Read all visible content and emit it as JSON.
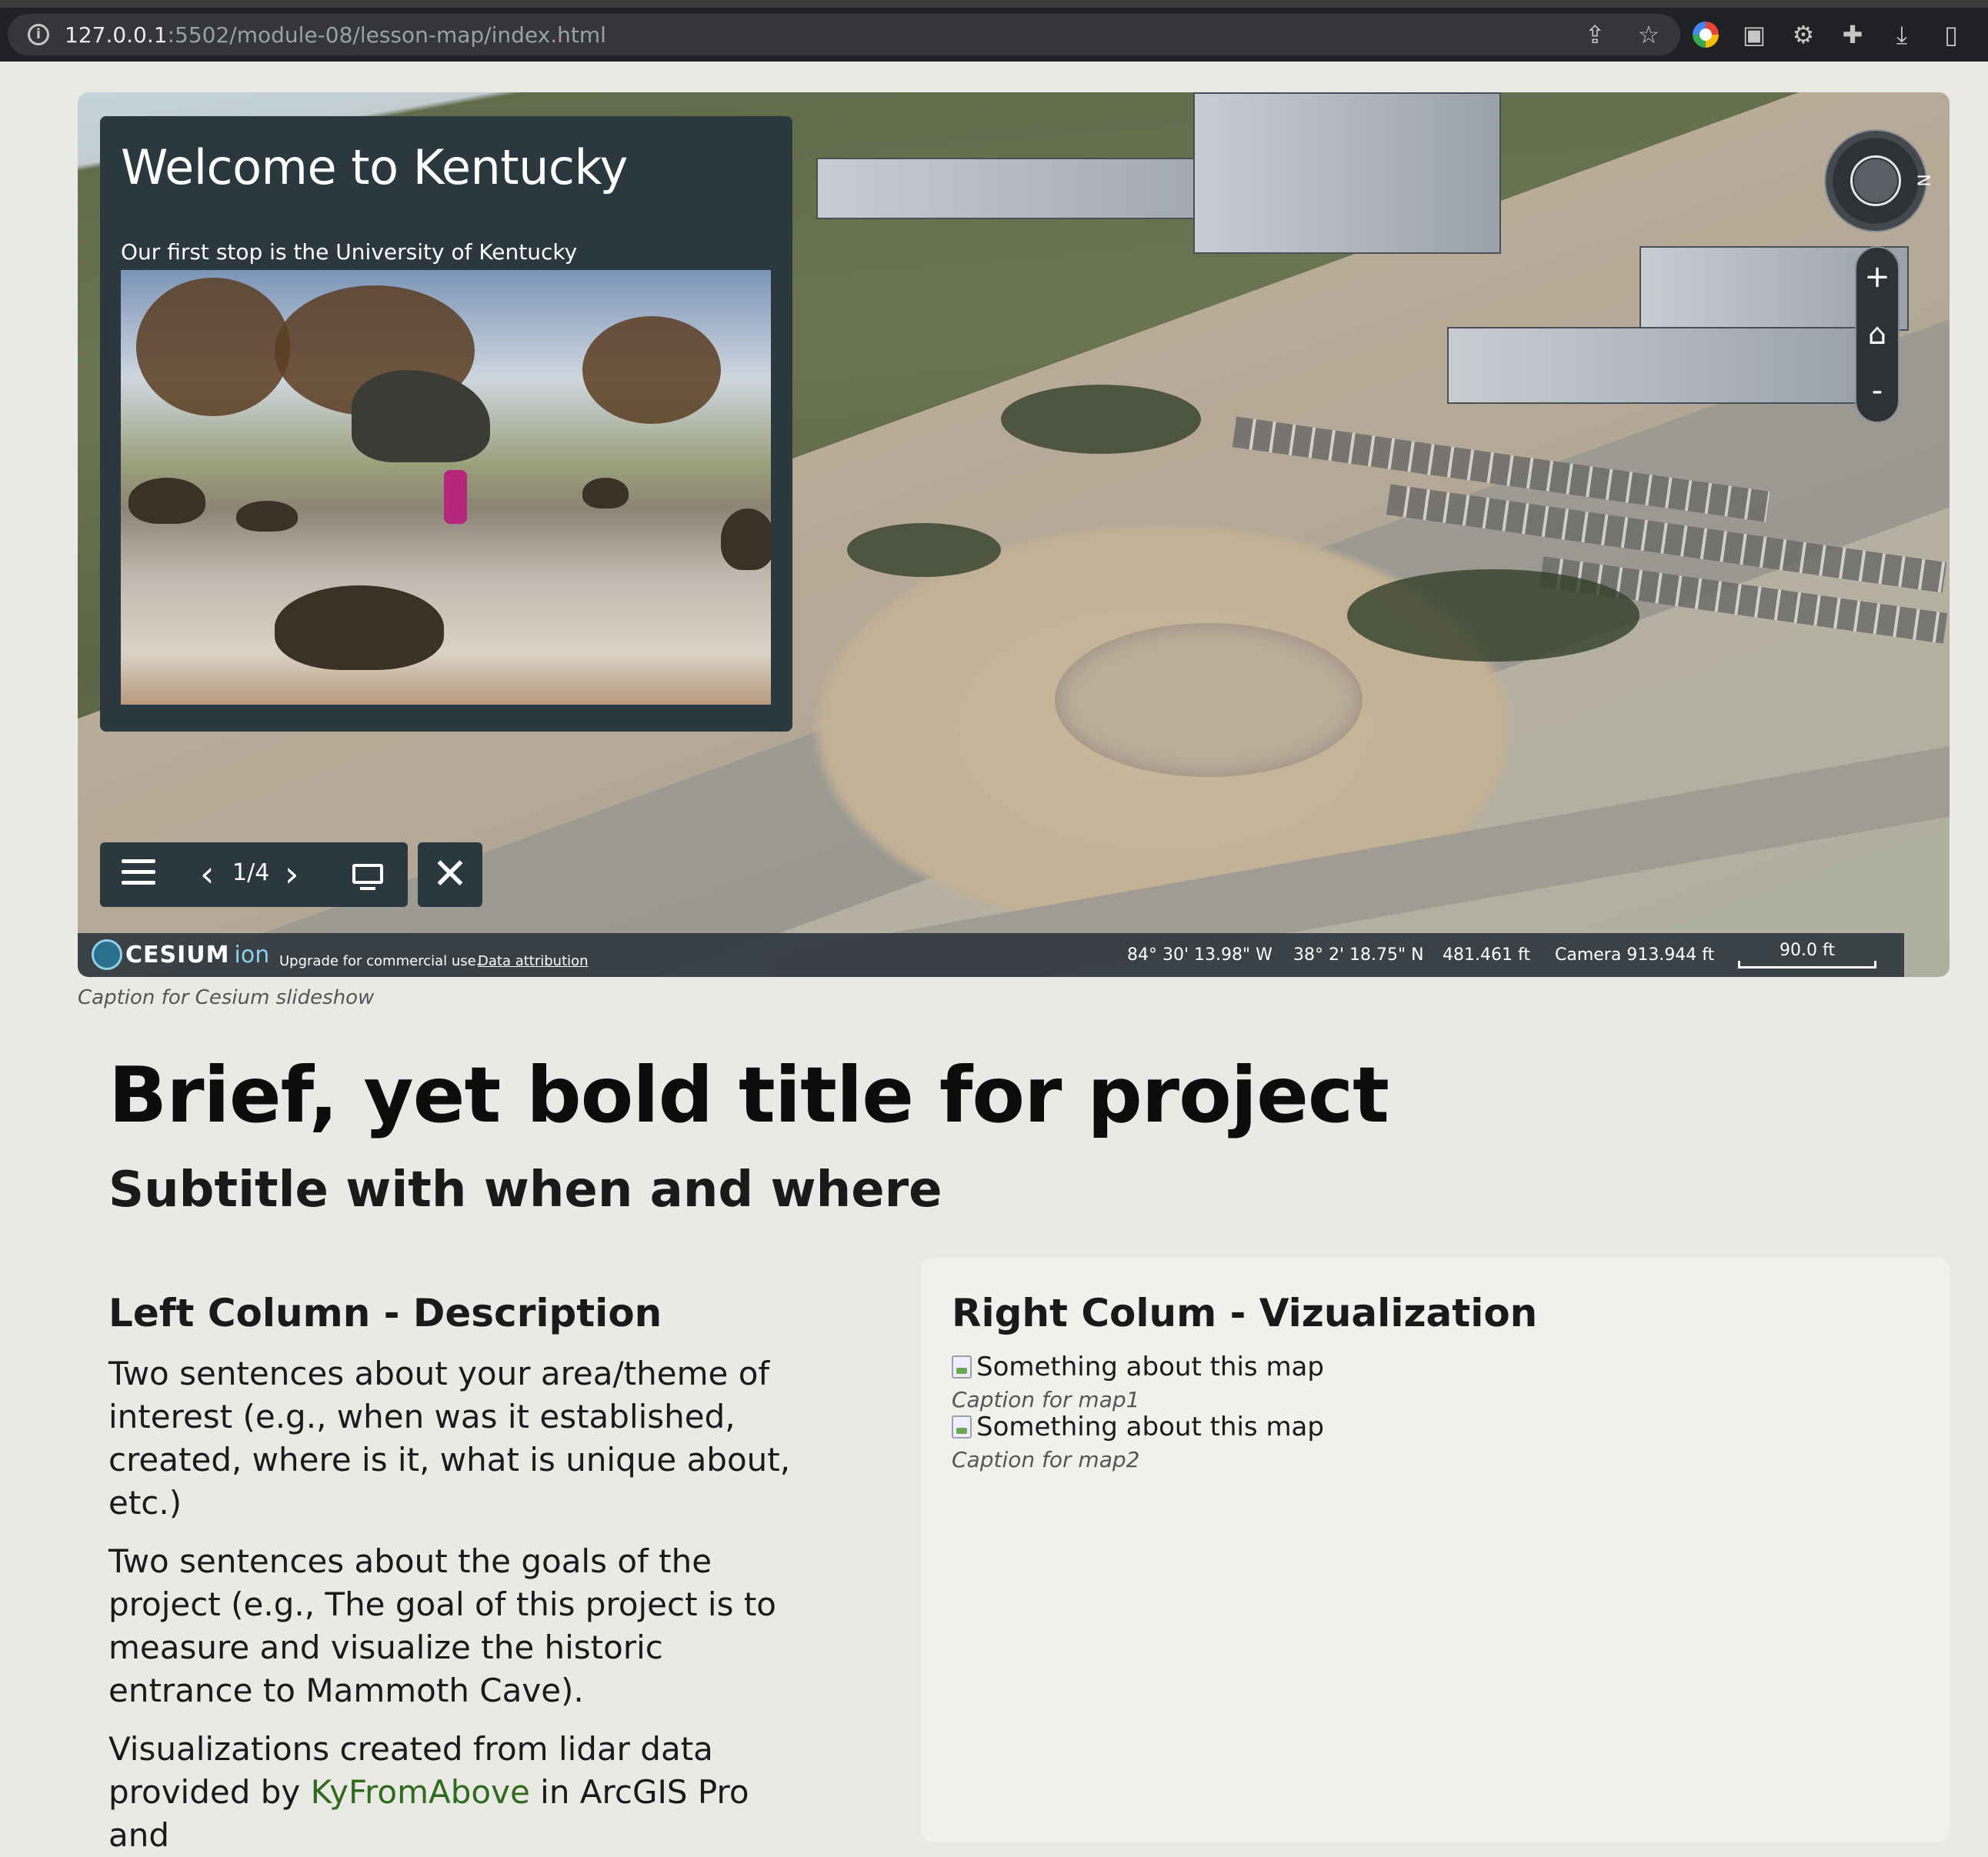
{
  "browser": {
    "url_host": "127.0.0.1",
    "url_path": ":5502/module-08/lesson-map/index.html",
    "icons": [
      "share-icon",
      "star-icon",
      "chrome-extension-icon",
      "translate-icon",
      "gear-icon",
      "puzzle-icon",
      "download-icon",
      "sidebar-icon"
    ]
  },
  "slideshow": {
    "panel_title": "Welcome to Kentucky",
    "panel_subtitle": "Our first stop is the University of Kentucky",
    "counter": "1/4",
    "nav_plus": "+",
    "nav_minus": "-",
    "compass_label": "N"
  },
  "credits": {
    "logo_word": "CESIUM",
    "logo_ion": "ion",
    "upgrade": "Upgrade for commercial use.",
    "attribution": "Data attribution",
    "longitude": "84° 30' 13.98\" W",
    "latitude": "38° 2' 18.75\" N",
    "elevation": "481.461 ft",
    "camera": "Camera 913.944 ft",
    "scale": "90.0 ft"
  },
  "viewer_caption": "Caption for Cesium slideshow",
  "page": {
    "title": "Brief, yet bold title for project",
    "subtitle": "Subtitle with when and where",
    "left_heading": "Left Column - Description",
    "para1": "Two sentences about your area/theme of interest (e.g., when was it established, created, where is it, what is unique about, etc.)",
    "para2": "Two sentences about the goals of the project (e.g., The goal of this project is to measure and visualize the historic entrance to Mammoth Cave).",
    "para3_before": "Visualizations created from lidar data provided by ",
    "para3_link": "KyFromAbove",
    "para3_after": " in ArcGIS Pro and",
    "right_heading": "Right Colum - Vizualization",
    "map1_alt": "Something about this map",
    "map1_caption": "Caption for map1",
    "map2_alt": "Something about this map",
    "map2_caption": "Caption for map2"
  }
}
